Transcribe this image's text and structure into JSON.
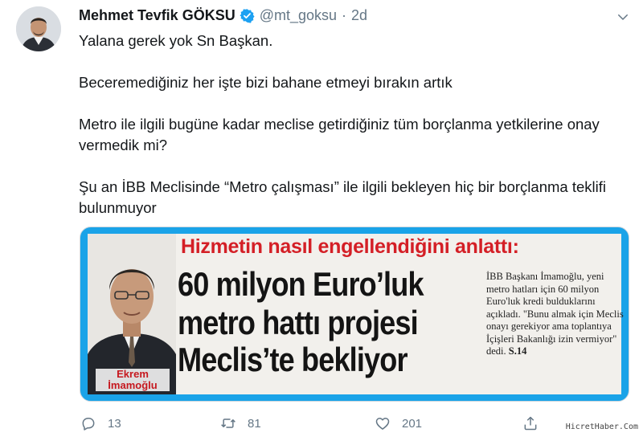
{
  "tweet": {
    "author_name": "Mehmet Tevfik GÖKSU",
    "handle": "@mt_goksu",
    "separator": "·",
    "time": "2d",
    "lines": [
      "Yalana gerek yok Sn Başkan.",
      "Beceremediğiniz her işte bizi bahane etmeyi bırakın artık",
      "Metro ile ilgili bugüne kadar meclise getirdiğiniz tüm borçlanma yetkilerine onay vermedik mi?",
      "Şu an İBB Meclisinde “Metro çalışması” ile ilgili bekleyen hiç bir borçlanma teklifi bulunmuyor"
    ]
  },
  "media": {
    "headline_top": "Hizmetin nasıl engellendiğini anlattı:",
    "headline_line1": "60 milyon Euro’luk",
    "headline_line2": "metro hattı projesi",
    "headline_line3": "Meclis’te bekliyor",
    "side_text": "İBB Başkanı İmamoğlu, yeni metro hatları için 60 milyon Euro'luk kredi bulduklarını açıkladı. \"Bunu almak için Meclis onayı gerekiyor ama toplantıya İçişleri Bakanlığı izin vermiyor\" dedi.",
    "side_page": "S.14",
    "caption_first": "Ekrem",
    "caption_last": "İmamoğlu",
    "frame_color": "#1aa3e8",
    "headline_color": "#d41f26"
  },
  "actions": {
    "reply_count": "13",
    "retweet_count": "81",
    "like_count": "201"
  },
  "watermark": "HicretHaber.Com",
  "colors": {
    "verified": "#1da1f2",
    "muted": "#657786"
  }
}
